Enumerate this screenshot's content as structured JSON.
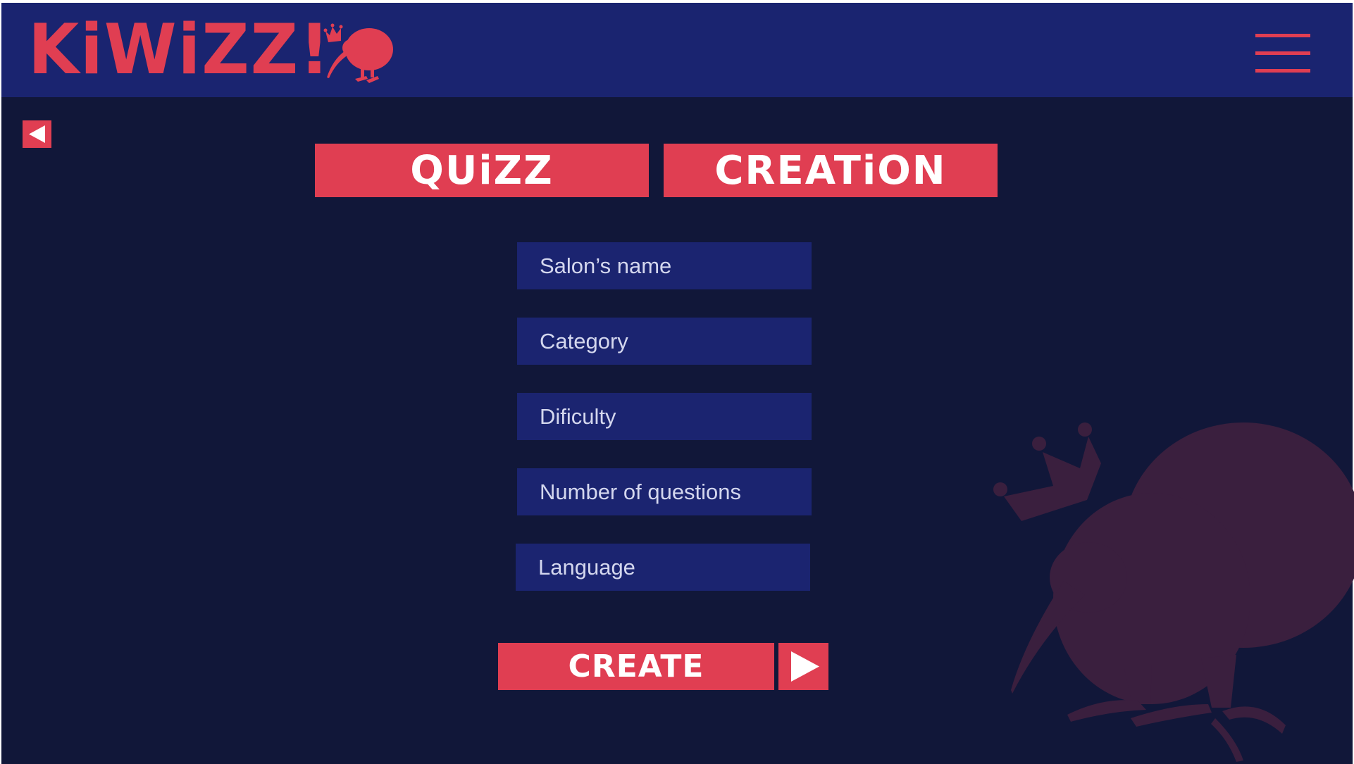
{
  "brand": {
    "logo_text": "KiWiZZ!",
    "accent_color": "#e03e52"
  },
  "header": {
    "menu_icon": "hamburger-menu-icon",
    "background": "#1a2470"
  },
  "nav": {
    "back_icon": "arrow-left-icon"
  },
  "titles": {
    "quizz": "QUiZZ",
    "creation": "CREATiON"
  },
  "form": {
    "salon_name": {
      "placeholder": "Salon’s name",
      "value": ""
    },
    "category": {
      "placeholder": "Category",
      "value": ""
    },
    "difficulty": {
      "placeholder": "Dificulty",
      "value": ""
    },
    "num_questions": {
      "placeholder": "Number of questions",
      "value": ""
    },
    "language": {
      "placeholder": "Language",
      "value": ""
    }
  },
  "actions": {
    "create_label": "CREATE",
    "play_icon": "play-icon"
  },
  "background": {
    "color": "#111739",
    "decoration": "kiwi-bird-crown-icon"
  }
}
